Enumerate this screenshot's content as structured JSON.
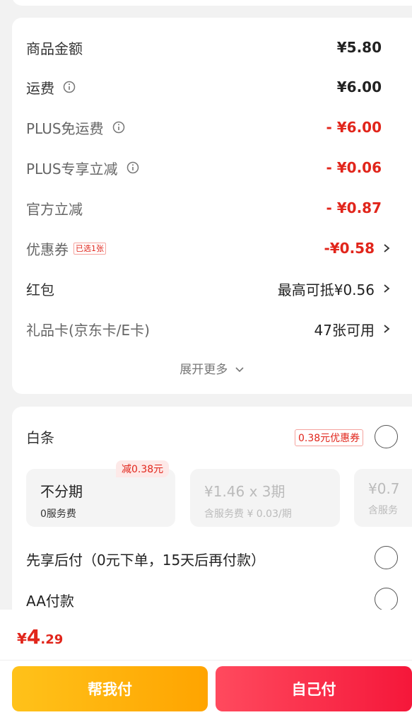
{
  "summary": {
    "rows": [
      {
        "label": "商品金额",
        "value": "¥5.80"
      },
      {
        "label": "运费",
        "value": "¥6.00"
      },
      {
        "label": "PLUS免运费",
        "value": "- ¥6.00"
      },
      {
        "label": "PLUS专享立减",
        "value": "- ¥0.06"
      },
      {
        "label": "官方立减",
        "value": "- ¥0.87"
      },
      {
        "label": "优惠券",
        "badge": "已选1张",
        "value": "-¥0.58"
      },
      {
        "label": "红包",
        "value": "最高可抵¥0.56"
      },
      {
        "label": "礼品卡(京东卡/E卡)",
        "value": "47张可用"
      }
    ],
    "expand_label": "展开更多"
  },
  "payment": {
    "baitiao_label": "白条",
    "baitiao_coupon": "0.38元优惠券",
    "plans": [
      {
        "title": "不分期",
        "sub": "0服务费",
        "tag": "减0.38元"
      },
      {
        "title": "¥1.46 x 3期",
        "sub": "含服务费 ¥ 0.03/期"
      },
      {
        "title": "¥0.7",
        "sub": "含服务"
      }
    ],
    "pay_later": "先享后付（0元下单，15天后再付款）",
    "aa_pay": "AA付款"
  },
  "footer": {
    "total_symbol": "¥",
    "total_int": "4",
    "total_dec": ".29",
    "help_pay": "帮我付",
    "self_pay": "自己付"
  },
  "colors": {
    "accent_red": "#e1251b",
    "help_button": "#ffb20a",
    "self_button": "#f5173a"
  }
}
